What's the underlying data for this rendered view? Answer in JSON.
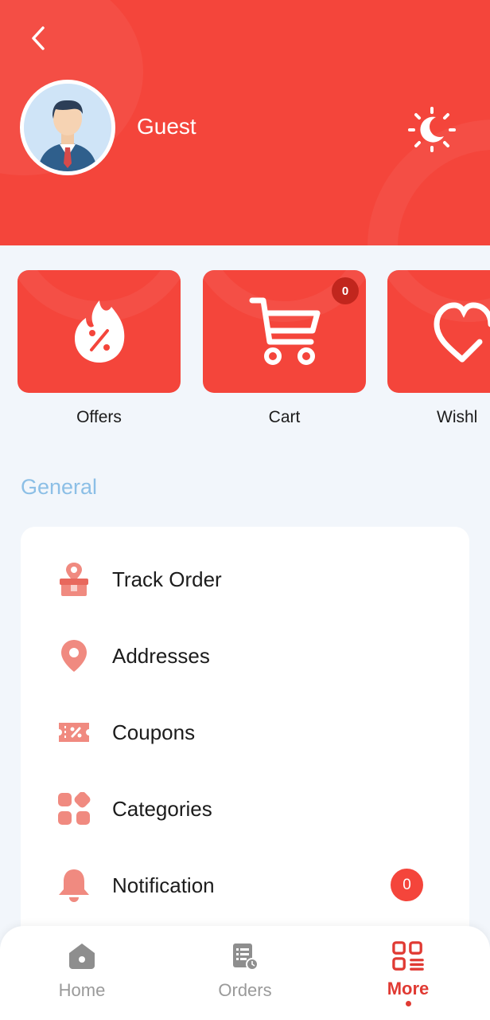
{
  "header": {
    "user_name": "Guest"
  },
  "quick_actions": [
    {
      "label": "Offers",
      "icon": "offer-flame-icon"
    },
    {
      "label": "Cart",
      "icon": "cart-icon",
      "badge": "0"
    },
    {
      "label": "Wishl",
      "icon": "heart-icon"
    }
  ],
  "section_title": "General",
  "menu": [
    {
      "label": "Track Order",
      "icon": "track-order-icon"
    },
    {
      "label": "Addresses",
      "icon": "location-pin-icon"
    },
    {
      "label": "Coupons",
      "icon": "coupon-icon"
    },
    {
      "label": "Categories",
      "icon": "categories-icon"
    },
    {
      "label": "Notification",
      "icon": "bell-icon",
      "badge": "0"
    }
  ],
  "bottom_nav": [
    {
      "label": "Home",
      "icon": "home-icon"
    },
    {
      "label": "Orders",
      "icon": "orders-icon"
    },
    {
      "label": "More",
      "icon": "more-grid-icon",
      "active": true
    }
  ],
  "colors": {
    "primary": "#f4453b",
    "background": "#f2f6fb",
    "section_title": "#8cbfe6",
    "icon_tint": "#f08a80"
  }
}
